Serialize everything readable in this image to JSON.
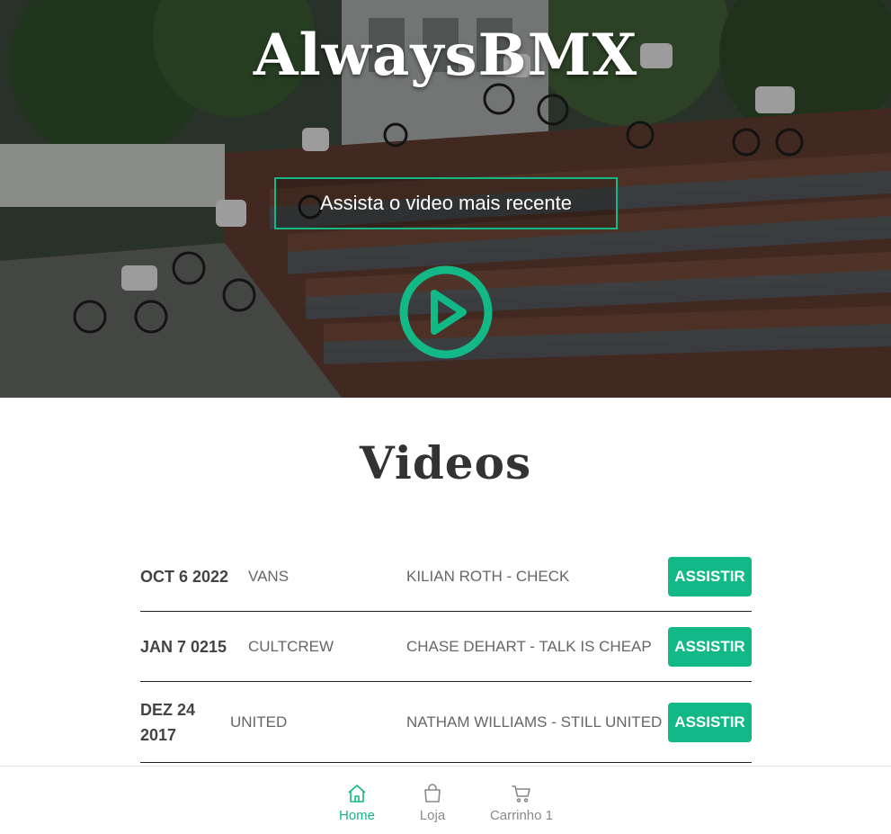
{
  "hero": {
    "title": "AlwaysBMX",
    "cta_label": "Assista o video mais recente",
    "play_icon": "play-circle-icon"
  },
  "videos": {
    "section_title": "Videos",
    "action_label": "ASSISTIR",
    "rows": [
      {
        "date": "OCT 6 2022",
        "brand": "VANS",
        "title": "KILIAN ROTH - CHECK"
      },
      {
        "date": "JAN 7 0215",
        "brand": "CULTCREW",
        "title": "CHASE DEHART - TALK IS CHEAP"
      },
      {
        "date": "DEZ 24 2017",
        "brand": "UNITED",
        "title": "NATHAM WILLIAMS - STILL UNITED"
      }
    ]
  },
  "nav": {
    "items": [
      {
        "label": "Home",
        "icon": "home-icon",
        "active": true
      },
      {
        "label": "Loja",
        "icon": "bag-icon",
        "active": false
      },
      {
        "label": "Carrinho 1",
        "icon": "cart-icon",
        "active": false
      }
    ]
  },
  "colors": {
    "accent": "#12b886",
    "text": "#333333",
    "muted": "#888888"
  }
}
